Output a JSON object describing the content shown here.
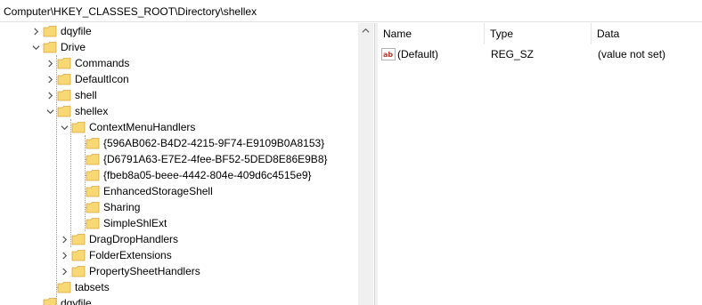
{
  "address": {
    "path": "Computer\\HKEY_CLASSES_ROOT\\Directory\\shellex"
  },
  "tree": {
    "items": [
      {
        "label": "dqyfile",
        "expanded": false
      },
      {
        "label": "Drive",
        "expanded": true
      },
      {
        "label": "Commands",
        "expanded": false
      },
      {
        "label": "DefaultIcon",
        "expanded": false
      },
      {
        "label": "shell",
        "expanded": false
      },
      {
        "label": "shellex",
        "expanded": true
      },
      {
        "label": "ContextMenuHandlers",
        "expanded": true
      },
      {
        "label": "{596AB062-B4D2-4215-9F74-E9109B0A8153}"
      },
      {
        "label": "{D6791A63-E7E2-4fee-BF52-5DED8E86E9B8}"
      },
      {
        "label": "{fbeb8a05-beee-4442-804e-409d6c4515e9}"
      },
      {
        "label": "EnhancedStorageShell"
      },
      {
        "label": "Sharing"
      },
      {
        "label": "SimpleShlExt"
      },
      {
        "label": "DragDropHandlers",
        "expanded": false
      },
      {
        "label": "FolderExtensions",
        "expanded": false
      },
      {
        "label": "PropertySheetHandlers",
        "expanded": false
      },
      {
        "label": "tabsets"
      },
      {
        "label": "dqyfile"
      }
    ]
  },
  "list": {
    "columns": {
      "name": "Name",
      "type": "Type",
      "data": "Data"
    },
    "rows": [
      {
        "name": "(Default)",
        "type": "REG_SZ",
        "data": "(value not set)"
      }
    ]
  },
  "colors": {
    "folder_fill": "#f8d775",
    "folder_edge": "#d9a73a",
    "ab_icon": "#c0392b"
  }
}
